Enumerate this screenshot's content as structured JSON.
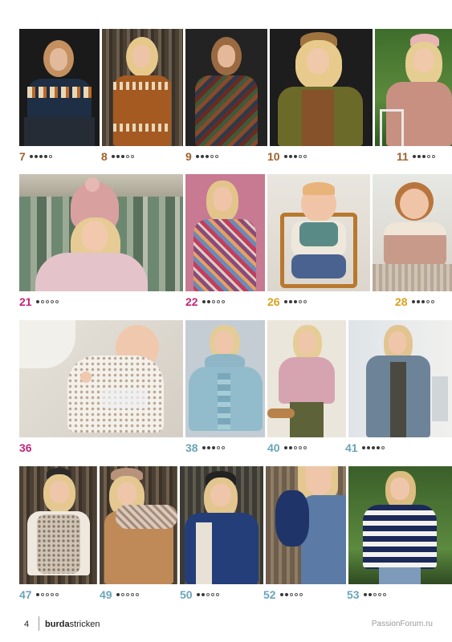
{
  "footer": {
    "page_number": "4",
    "brand_bold": "burda",
    "brand_light": "stricken",
    "watermark": "PassionForum.ru"
  },
  "colors": {
    "brown": "#a0612a",
    "magenta": "#c2257a",
    "gold": "#d8a21e",
    "teal": "#6aa5b8"
  },
  "rows": [
    {
      "items": [
        {
          "number": "7",
          "level": 4,
          "color": "brown"
        },
        {
          "number": "8",
          "level": 3,
          "color": "brown"
        },
        {
          "number": "9",
          "level": 3,
          "color": "brown"
        },
        {
          "number": "10",
          "level": 3,
          "color": "brown"
        },
        {
          "number": "11",
          "level": 3,
          "color": "brown"
        }
      ]
    },
    {
      "items": [
        {
          "number": "21",
          "level": 1,
          "color": "magenta"
        },
        {
          "number": "22",
          "level": 2,
          "color": "magenta"
        },
        {
          "number": "26",
          "level": 3,
          "color": "gold"
        },
        {
          "number": "28",
          "level": 3,
          "color": "gold"
        }
      ]
    },
    {
      "items": [
        {
          "number": "36",
          "level": 0,
          "color": "magenta"
        },
        {
          "number": "38",
          "level": 3,
          "color": "teal"
        },
        {
          "number": "40",
          "level": 2,
          "color": "teal"
        },
        {
          "number": "41",
          "level": 4,
          "color": "teal"
        }
      ]
    },
    {
      "items": [
        {
          "number": "47",
          "level": 1,
          "color": "teal"
        },
        {
          "number": "49",
          "level": 1,
          "color": "teal"
        },
        {
          "number": "50",
          "level": 2,
          "color": "teal"
        },
        {
          "number": "52",
          "level": 2,
          "color": "teal"
        },
        {
          "number": "53",
          "level": 2,
          "color": "teal"
        }
      ]
    }
  ]
}
